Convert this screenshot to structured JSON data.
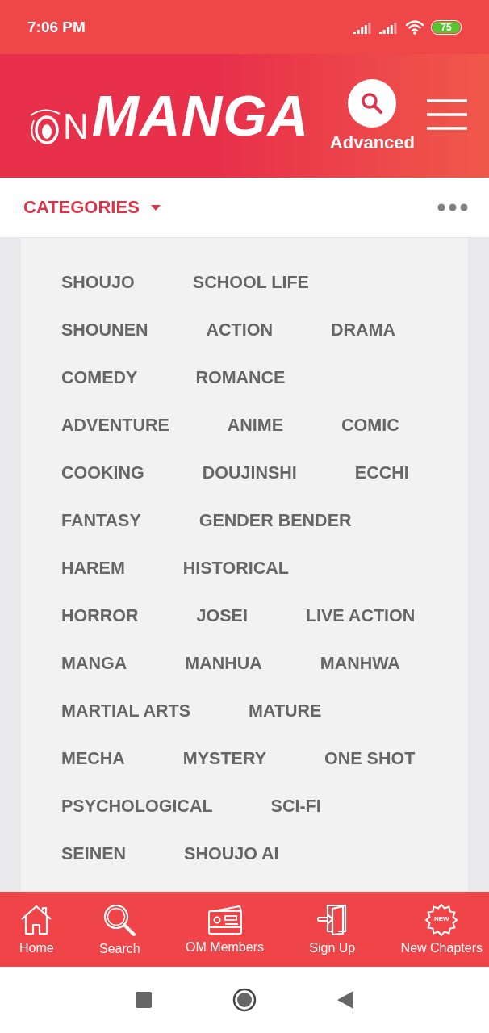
{
  "status_bar": {
    "time": "7:06 PM",
    "battery": "75"
  },
  "header": {
    "logo": {
      "lead": "N",
      "main": "MANGA"
    },
    "advanced_label": "Advanced"
  },
  "categories_bar": {
    "title": "CATEGORIES"
  },
  "category_rows": [
    [
      "SHOUJO",
      "SCHOOL LIFE"
    ],
    [
      "SHOUNEN",
      "ACTION",
      "DRAMA"
    ],
    [
      "COMEDY",
      "ROMANCE"
    ],
    [
      "ADVENTURE",
      "ANIME",
      "COMIC"
    ],
    [
      "COOKING",
      "DOUJINSHI",
      "ECCHI"
    ],
    [
      "FANTASY",
      "GENDER BENDER"
    ],
    [
      "HAREM",
      "HISTORICAL"
    ],
    [
      "HORROR",
      "JOSEI",
      "LIVE ACTION"
    ],
    [
      "MANGA",
      "MANHUA",
      "MANHWA"
    ],
    [
      "MARTIAL ARTS",
      "MATURE"
    ],
    [
      "MECHA",
      "MYSTERY",
      "ONE SHOT"
    ],
    [
      "PSYCHOLOGICAL",
      "SCI-FI"
    ],
    [
      "SEINEN",
      "SHOUJO AI"
    ]
  ],
  "bottom_nav": [
    {
      "kind": "home",
      "label": "Home"
    },
    {
      "kind": "search",
      "label": "Search"
    },
    {
      "kind": "members",
      "label": "OM Members"
    },
    {
      "kind": "signup",
      "label": "Sign Up"
    },
    {
      "kind": "new",
      "label": "New Chapters",
      "badge": "NEW"
    }
  ]
}
